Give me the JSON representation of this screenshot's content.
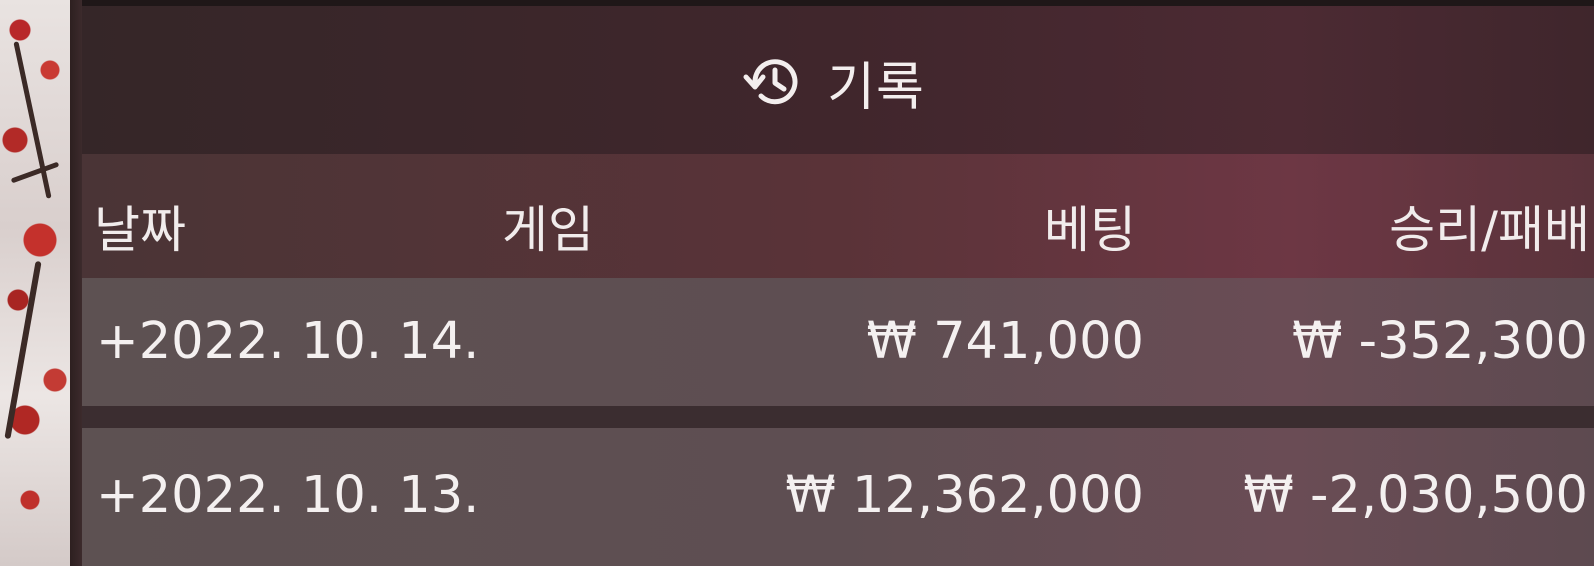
{
  "history": {
    "title": "기록",
    "title_icon": "history-icon",
    "columns": [
      "날짜",
      "게임",
      "베팅",
      "승리/패배"
    ],
    "rows": [
      {
        "date": "+2022. 10. 14.",
        "game": "",
        "bet": "₩ 741,000",
        "result": "₩ -352,300"
      },
      {
        "date": "+2022. 10. 13.",
        "game": "",
        "bet": "₩ 12,362,000",
        "result": "₩ -2,030,500"
      }
    ]
  },
  "colors": {
    "panel": "#45282e",
    "header": "#5a3338",
    "row": "#5e4e52",
    "text": "#f3eeee"
  }
}
